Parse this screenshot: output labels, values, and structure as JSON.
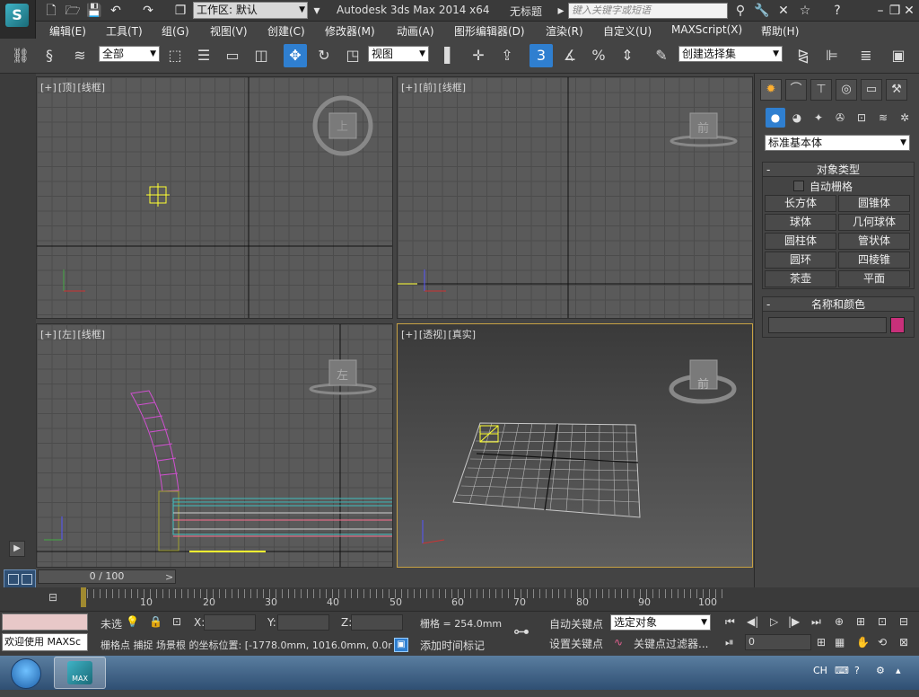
{
  "title_bar": {
    "workspace_label": "工作区: 默认",
    "app_title": "Autodesk 3ds Max  2014 x64",
    "document_name": "无标题",
    "search_placeholder": "键入关键字或短语"
  },
  "menu": [
    "编辑(E)",
    "工具(T)",
    "组(G)",
    "视图(V)",
    "创建(C)",
    "修改器(M)",
    "动画(A)",
    "图形编辑器(D)",
    "渲染(R)",
    "自定义(U)",
    "MAXScript(X)",
    "帮助(H)"
  ],
  "toolbar": {
    "selection_filter": "全部",
    "ref_coord": "视图",
    "snap_value": "3",
    "named_selection": "创建选择集"
  },
  "viewports": {
    "top": {
      "plus": "[+]",
      "name": "[顶]",
      "mode": "[线框]",
      "cube_label": "上"
    },
    "front": {
      "plus": "[+]",
      "name": "[前]",
      "mode": "[线框]",
      "cube_label": "前"
    },
    "left": {
      "plus": "[+]",
      "name": "[左]",
      "mode": "[线框]",
      "cube_label": "左"
    },
    "perspective": {
      "plus": "[+]",
      "name": "[透视]",
      "mode": "[真实]",
      "cube_label": "前"
    }
  },
  "command_panel": {
    "category": "标准基本体",
    "object_type_title": "对象类型",
    "autogrid_label": "自动栅格",
    "object_buttons": [
      "长方体",
      "圆锥体",
      "球体",
      "几何球体",
      "圆柱体",
      "管状体",
      "圆环",
      "四棱锥",
      "茶壶",
      "平面"
    ],
    "name_color_title": "名称和颜色",
    "object_color": "#c8307a"
  },
  "timeline": {
    "frame_label": "0 / 100",
    "ticks": [
      "10",
      "20",
      "30",
      "40",
      "50",
      "60",
      "70",
      "80",
      "90",
      "100"
    ]
  },
  "status": {
    "maxscript_welcome": "欢迎使用 MAXSc",
    "selection_label": "未选",
    "x_label": "X:",
    "y_label": "Y:",
    "z_label": "Z:",
    "grid_label": "栅格 = 254.0mm",
    "prompt": "栅格点 捕捉 场景根 的坐标位置: [-1778.0mm, 1016.0mm, 0.0r",
    "add_time_tag": "添加时间标记",
    "auto_key": "自动关键点",
    "set_key": "设置关键点",
    "key_mode": "选定对象",
    "key_filters": "关键点过滤器...",
    "current_frame": "0"
  },
  "taskbar": {
    "lang": "CH",
    "app_caption": "MAX"
  }
}
